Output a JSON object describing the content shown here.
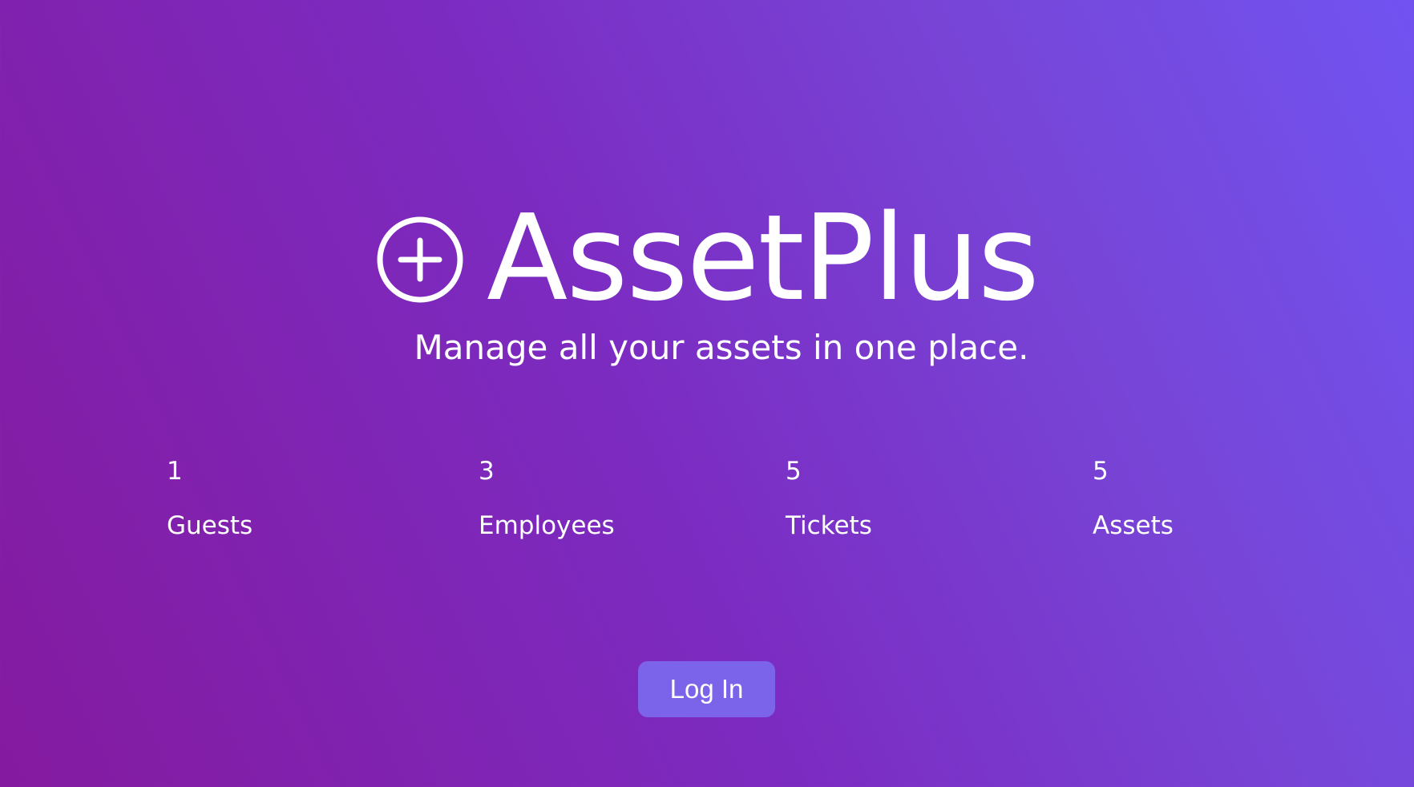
{
  "brand": {
    "name": "AssetPlus",
    "icon": "plus-circle-icon",
    "tagline": "Manage all your assets in one place."
  },
  "stats": [
    {
      "count": "1",
      "label": "Guests"
    },
    {
      "count": "3",
      "label": "Employees"
    },
    {
      "count": "5",
      "label": "Tickets"
    },
    {
      "count": "5",
      "label": "Assets"
    }
  ],
  "actions": {
    "login_label": "Log In"
  },
  "colors": {
    "gradient_start": "#841a9f",
    "gradient_end": "#7153f1",
    "button_bg": "#7b63ea",
    "text": "#ffffff"
  }
}
